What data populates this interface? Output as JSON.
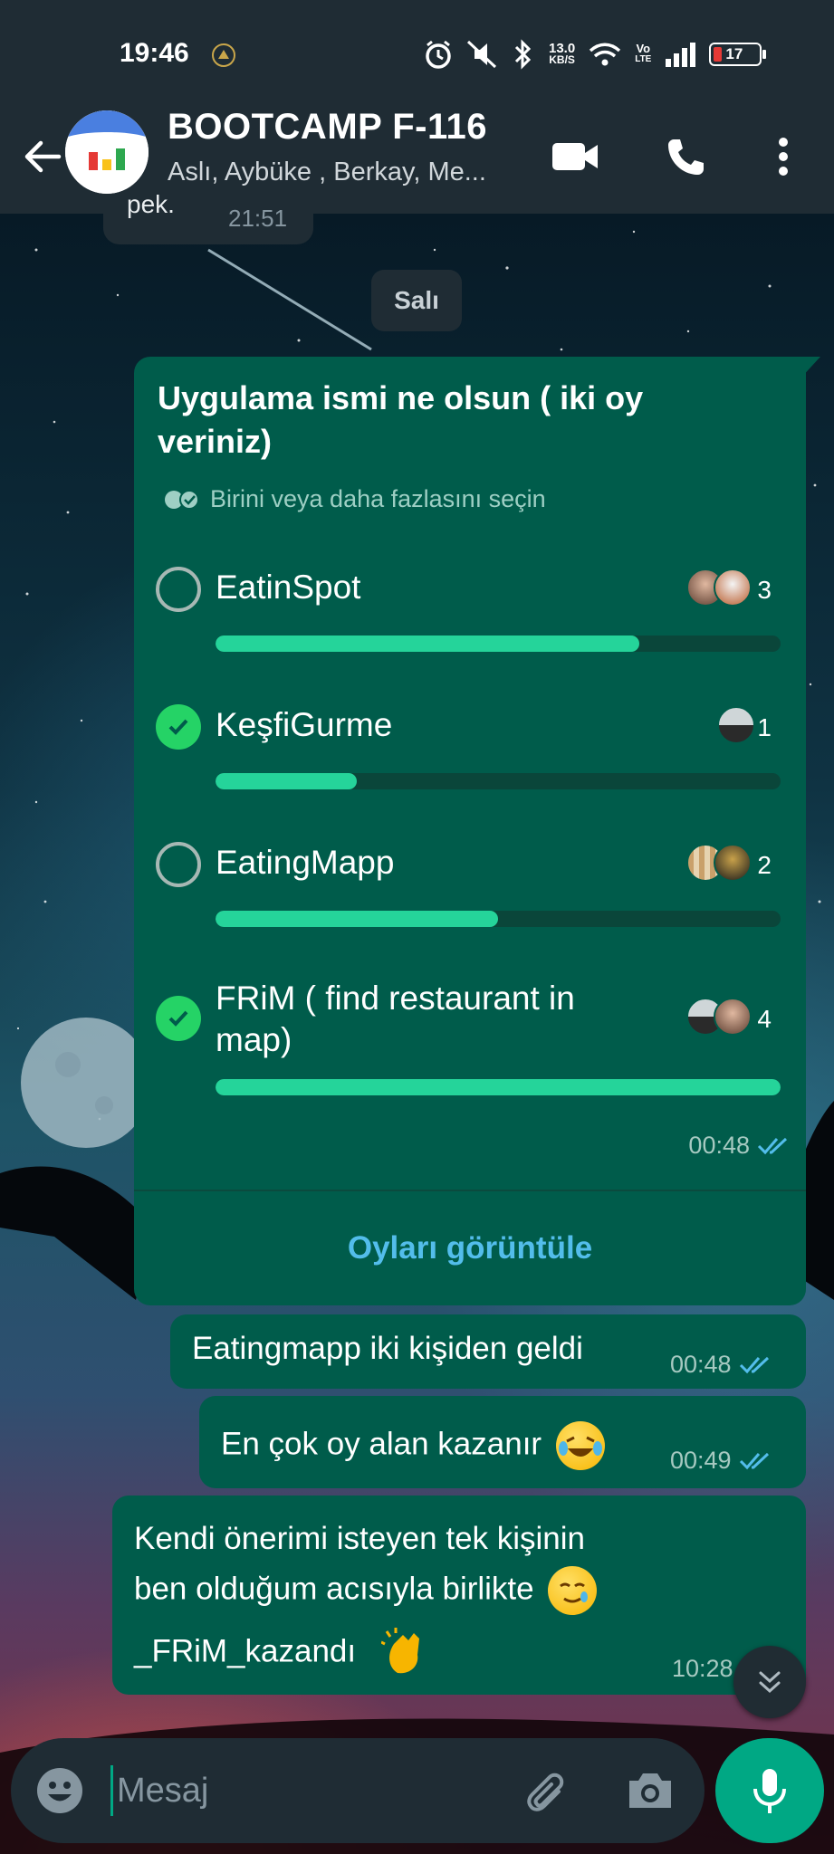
{
  "status_bar": {
    "time": "19:46",
    "net_speed_value": "13.0",
    "net_speed_unit": "KB/S",
    "lte_top": "Vo",
    "lte_bottom": "LTE",
    "battery": "17"
  },
  "header": {
    "title": "BOOTCAMP F-116",
    "subtitle": "Aslı, Aybüke , Berkay, Me..."
  },
  "previous_message": {
    "text": "pek.",
    "time": "21:51"
  },
  "date_separator": "Salı",
  "poll": {
    "question": "Uygulama ismi ne olsun ( iki oy veriniz)",
    "hint": "Birini veya daha fazlasını seçin",
    "options": [
      {
        "label": "EatinSpot",
        "votes": "3",
        "fraction": 0.75,
        "checked": false
      },
      {
        "label": "KeşfiGurme",
        "votes": "1",
        "fraction": 0.25,
        "checked": true
      },
      {
        "label": "EatingMapp",
        "votes": "2",
        "fraction": 0.5,
        "checked": false
      },
      {
        "label": "FRiM ( find restaurant in map)",
        "votes": "4",
        "fraction": 1.0,
        "checked": true
      }
    ],
    "time": "00:48",
    "view_votes": "Oyları görüntüle"
  },
  "messages": [
    {
      "text": "Eatingmapp iki kişiden geldi",
      "time": "00:48"
    },
    {
      "text": "En çok oy alan kazanır",
      "time": "00:49"
    },
    {
      "line1": "Kendi önerimi isteyen tek kişinin",
      "line2": "ben olduğum acısıyla birlikte",
      "line3": "_FRiM_kazandı",
      "time": "10:28"
    }
  ],
  "input": {
    "placeholder": "Mesaj"
  },
  "colors": {
    "outgoing_bubble": "#005c4b",
    "accent": "#00a884",
    "link": "#53bdeb",
    "read_ticks": "#53bdeb"
  },
  "icons": [
    "back-arrow-icon",
    "video-call-icon",
    "phone-icon",
    "more-vert-icon",
    "double-check-icon",
    "check-icon",
    "emoji-icon",
    "attach-icon",
    "camera-icon",
    "mic-icon",
    "chevron-down-icon"
  ]
}
